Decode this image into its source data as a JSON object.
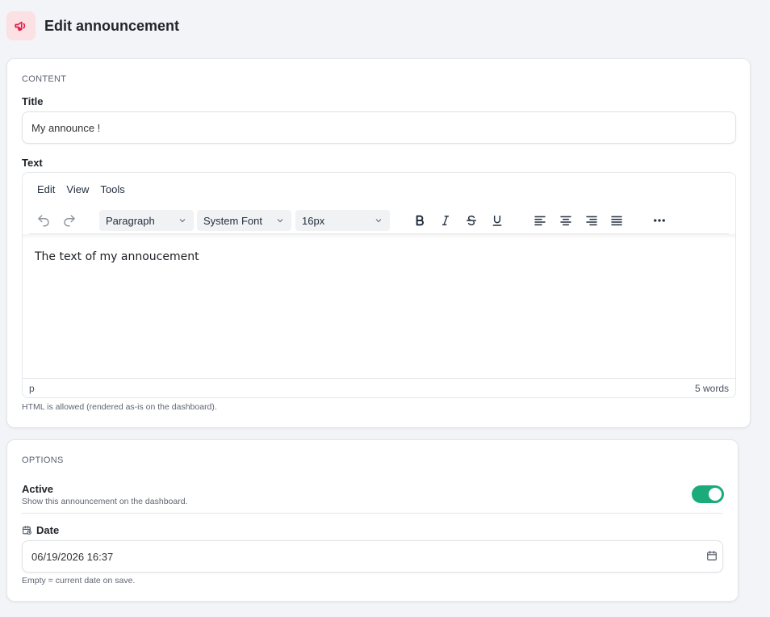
{
  "header": {
    "title": "Edit announcement",
    "icon": "megaphone-icon",
    "accent": "#e11d48"
  },
  "content": {
    "section_label": "CONTENT",
    "title_label": "Title",
    "title_value": "My announce !",
    "text_label": "Text",
    "editor": {
      "menu": [
        "Edit",
        "View",
        "Tools"
      ],
      "block_format": "Paragraph",
      "font_family": "System Font",
      "font_size": "16px",
      "body": "The text of my annoucement",
      "status_path": "p",
      "word_count": "5 words"
    },
    "help": "HTML is allowed (rendered as-is on the dashboard)."
  },
  "options": {
    "section_label": "OPTIONS",
    "active_label": "Active",
    "active_desc": "Show this announcement on the dashboard.",
    "active_on": true,
    "toggle_color": "#1bab7a",
    "date_label": "Date",
    "date_value": "06/19/2026 16:37",
    "date_help": "Empty = current date on save."
  }
}
